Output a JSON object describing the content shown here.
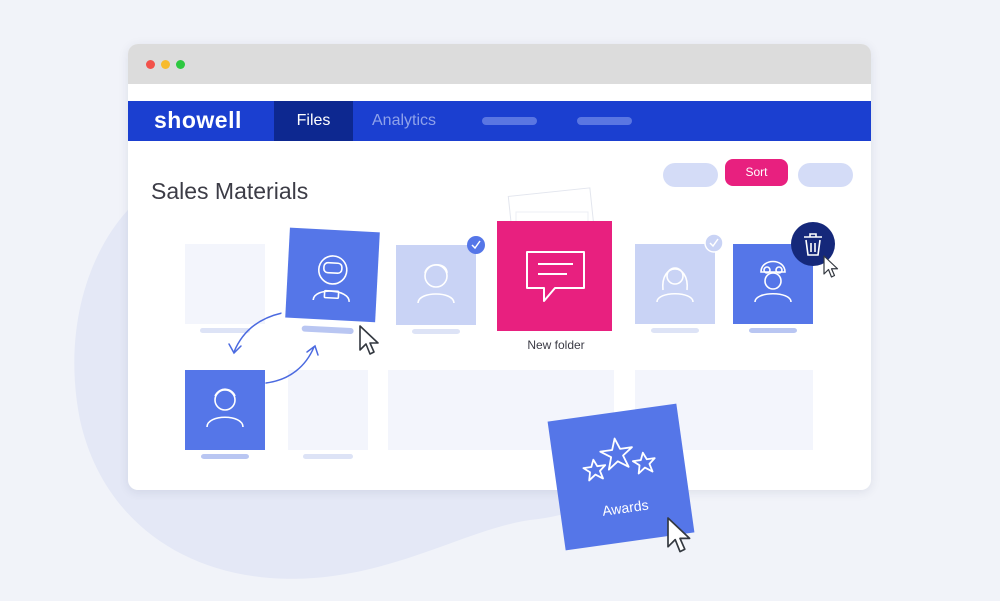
{
  "window": {
    "traffic_lights": [
      "#f2524b",
      "#f7bb2e",
      "#2dc840"
    ]
  },
  "nav": {
    "logo": "showell",
    "tabs": [
      {
        "label": "Files",
        "active": true
      },
      {
        "label": "Analytics",
        "active": false
      }
    ]
  },
  "toolbar": {
    "sort_label": "Sort"
  },
  "page": {
    "title": "Sales Materials"
  },
  "folders": {
    "new_folder_label": "New folder"
  },
  "awards": {
    "label": "Awards"
  },
  "colors": {
    "nav_blue": "#1b3fd0",
    "active_tab": "#0d2890",
    "accent_pink": "#e8207f",
    "card_blue": "#5576e8",
    "card_light": "#c9d3f5",
    "trash_navy": "#15287a"
  },
  "icons": [
    "astronaut-icon",
    "person-icon",
    "woman-icon",
    "soldier-icon",
    "chat-icon",
    "stars-icon",
    "trash-icon",
    "check-icon",
    "cursor-icon",
    "swap-arrows-icon"
  ]
}
